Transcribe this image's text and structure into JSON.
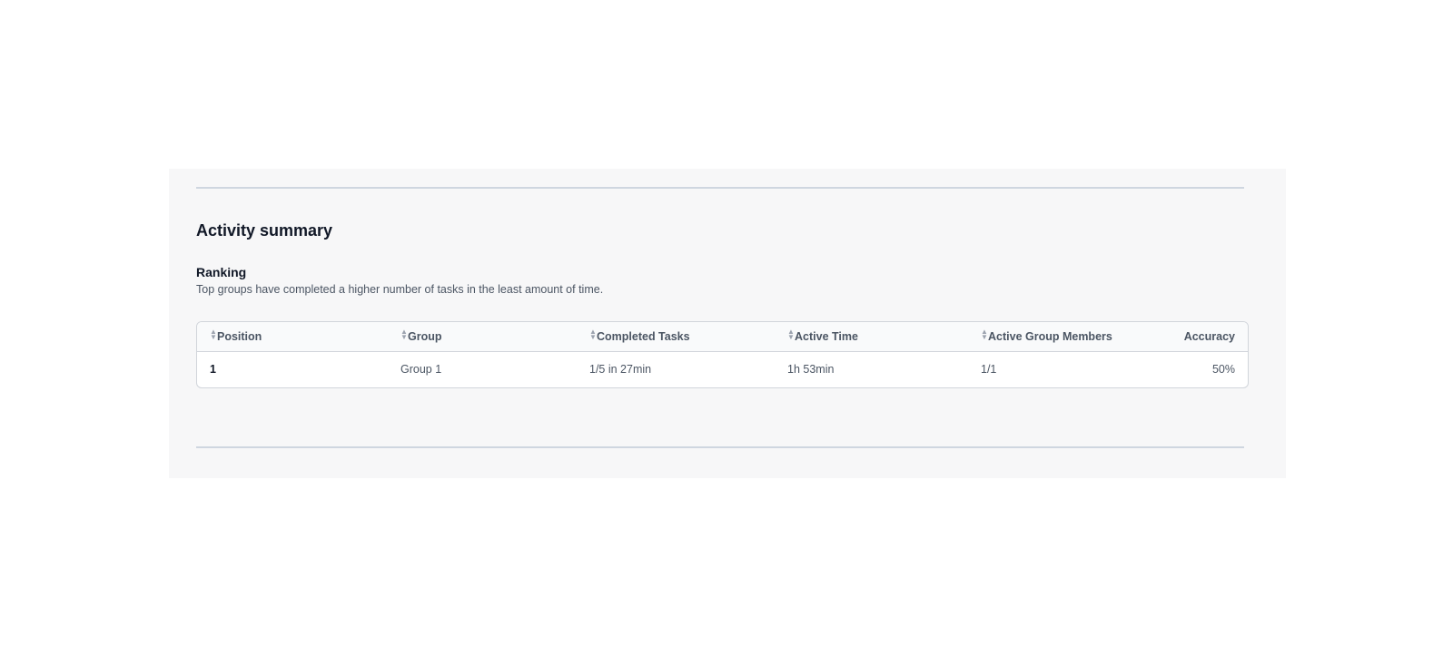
{
  "section": {
    "title": "Activity summary"
  },
  "ranking": {
    "title": "Ranking",
    "description": "Top groups have completed a higher number of tasks in the least amount of time.",
    "columns": {
      "position": "Position",
      "group": "Group",
      "completed_tasks": "Completed Tasks",
      "active_time": "Active Time",
      "active_group_members": "Active Group Members",
      "accuracy": "Accuracy"
    },
    "rows": [
      {
        "position": "1",
        "group": "Group 1",
        "completed_tasks": "1/5 in 27min",
        "active_time": "1h 53min",
        "active_group_members": "1/1",
        "accuracy": "50%"
      }
    ]
  },
  "colors": {
    "panel_background": "#f7f7f8",
    "divider": "#cfd6e0",
    "table_border": "#d1d5db",
    "header_text": "#4b5563",
    "title_text": "#111827"
  },
  "icons": {
    "sort": "sort-up-down-icon"
  }
}
